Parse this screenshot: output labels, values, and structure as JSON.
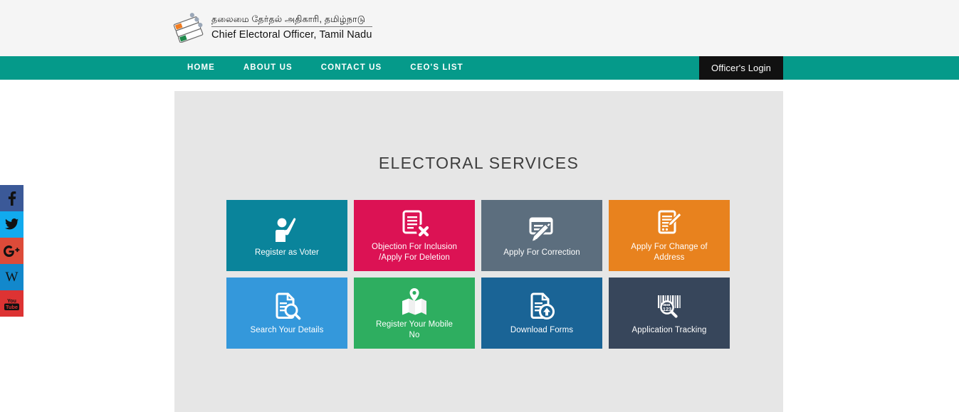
{
  "header": {
    "logo_icon": "election-commission-evm-logo",
    "title_tamil": "தலைமை தேர்தல் அதிகாரி, தமிழ்நாடு",
    "title_english": "Chief Electoral Officer, Tamil Nadu"
  },
  "nav": {
    "background_color": "#059a8a",
    "items": [
      {
        "label": "HOME"
      },
      {
        "label": "ABOUT US"
      },
      {
        "label": "CONTACT US"
      },
      {
        "label": "CEO'S LIST"
      }
    ],
    "officer_login_label": "Officer's Login",
    "officer_login_color": "#111111"
  },
  "social": {
    "items": [
      {
        "name": "facebook",
        "glyph": "f",
        "color": "#3b5998"
      },
      {
        "name": "twitter",
        "glyph": "🐦",
        "color": "#11aaee"
      },
      {
        "name": "google-plus",
        "glyph": "G+",
        "color": "#dd4b39"
      },
      {
        "name": "wikipedia",
        "glyph": "W",
        "color": "#1288cc"
      },
      {
        "name": "youtube",
        "glyph": "You Tube",
        "color": "#dd3333"
      }
    ]
  },
  "main": {
    "panel_color": "#e6e6e6",
    "section_title": "ELECTORAL SERVICES",
    "tiles": [
      {
        "label": "Register as Voter",
        "color": "#0a849b",
        "icon": "person-raising-hand-icon"
      },
      {
        "label": "Objection For Inclusion /Apply For Deletion",
        "label_line1": "Objection For Inclusion",
        "label_line2": "/Apply For Deletion",
        "color": "#dc1254",
        "icon": "document-delete-icon"
      },
      {
        "label": "Apply For Correction",
        "color": "#5c6e7e",
        "icon": "form-pencil-icon"
      },
      {
        "label": "Apply For Change of Address",
        "label_line1": "Apply For Change of",
        "label_line2": "Address",
        "color": "#e8821e",
        "icon": "document-pen-icon"
      },
      {
        "label": "Search Your Details",
        "color": "#3498db",
        "icon": "document-search-icon"
      },
      {
        "label": "Register Your Mobile No",
        "label_line1": "Register Your Mobile",
        "label_line2": "No",
        "color": "#2eae60",
        "icon": "map-pin-icon"
      },
      {
        "label": "Download Forms",
        "color": "#1a6496",
        "icon": "document-download-icon"
      },
      {
        "label": "Application Tracking",
        "color": "#37465b",
        "icon": "barcode-search-icon"
      }
    ]
  }
}
